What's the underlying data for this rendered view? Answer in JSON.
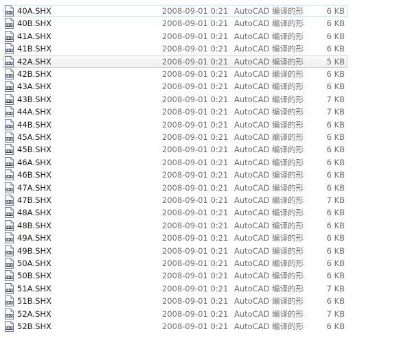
{
  "file_list": {
    "icon": "shx-file-icon",
    "icon_label": "SHX",
    "selected_index": 0,
    "hover_index": 4,
    "rows": [
      {
        "name": "40A.SHX",
        "date": "2008-09-01 0:21",
        "type": "AutoCAD 编译的形",
        "size": "6 KB"
      },
      {
        "name": "40B.SHX",
        "date": "2008-09-01 0:21",
        "type": "AutoCAD 编译的形",
        "size": "6 KB"
      },
      {
        "name": "41A.SHX",
        "date": "2008-09-01 0:21",
        "type": "AutoCAD 编译的形",
        "size": "6 KB"
      },
      {
        "name": "41B.SHX",
        "date": "2008-09-01 0:21",
        "type": "AutoCAD 编译的形",
        "size": "6 KB"
      },
      {
        "name": "42A.SHX",
        "date": "2008-09-01 0:21",
        "type": "AutoCAD 编译的形",
        "size": "5 KB"
      },
      {
        "name": "42B.SHX",
        "date": "2008-09-01 0:21",
        "type": "AutoCAD 编译的形",
        "size": "6 KB"
      },
      {
        "name": "43A.SHX",
        "date": "2008-09-01 0:21",
        "type": "AutoCAD 编译的形",
        "size": "6 KB"
      },
      {
        "name": "43B.SHX",
        "date": "2008-09-01 0:21",
        "type": "AutoCAD 编译的形",
        "size": "7 KB"
      },
      {
        "name": "44A.SHX",
        "date": "2008-09-01 0:21",
        "type": "AutoCAD 编译的形",
        "size": "7 KB"
      },
      {
        "name": "44B.SHX",
        "date": "2008-09-01 0:21",
        "type": "AutoCAD 编译的形",
        "size": "6 KB"
      },
      {
        "name": "45A.SHX",
        "date": "2008-09-01 0:21",
        "type": "AutoCAD 编译的形",
        "size": "6 KB"
      },
      {
        "name": "45B.SHX",
        "date": "2008-09-01 0:21",
        "type": "AutoCAD 编译的形",
        "size": "6 KB"
      },
      {
        "name": "46A.SHX",
        "date": "2008-09-01 0:21",
        "type": "AutoCAD 编译的形",
        "size": "6 KB"
      },
      {
        "name": "46B.SHX",
        "date": "2008-09-01 0:21",
        "type": "AutoCAD 编译的形",
        "size": "6 KB"
      },
      {
        "name": "47A.SHX",
        "date": "2008-09-01 0:21",
        "type": "AutoCAD 编译的形",
        "size": "6 KB"
      },
      {
        "name": "47B.SHX",
        "date": "2008-09-01 0:21",
        "type": "AutoCAD 编译的形",
        "size": "7 KB"
      },
      {
        "name": "48A.SHX",
        "date": "2008-09-01 0:21",
        "type": "AutoCAD 编译的形",
        "size": "6 KB"
      },
      {
        "name": "48B.SHX",
        "date": "2008-09-01 0:21",
        "type": "AutoCAD 编译的形",
        "size": "6 KB"
      },
      {
        "name": "49A.SHX",
        "date": "2008-09-01 0:21",
        "type": "AutoCAD 编译的形",
        "size": "6 KB"
      },
      {
        "name": "49B.SHX",
        "date": "2008-09-01 0:21",
        "type": "AutoCAD 编译的形",
        "size": "6 KB"
      },
      {
        "name": "50A.SHX",
        "date": "2008-09-01 0:21",
        "type": "AutoCAD 编译的形",
        "size": "6 KB"
      },
      {
        "name": "50B.SHX",
        "date": "2008-09-01 0:21",
        "type": "AutoCAD 编译的形",
        "size": "6 KB"
      },
      {
        "name": "51A.SHX",
        "date": "2008-09-01 0:21",
        "type": "AutoCAD 编译的形",
        "size": "7 KB"
      },
      {
        "name": "51B.SHX",
        "date": "2008-09-01 0:21",
        "type": "AutoCAD 编译的形",
        "size": "6 KB"
      },
      {
        "name": "52A.SHX",
        "date": "2008-09-01 0:21",
        "type": "AutoCAD 编译的形",
        "size": "7 KB"
      },
      {
        "name": "52B.SHX",
        "date": "2008-09-01 0:21",
        "type": "AutoCAD 编译的形",
        "size": "6 KB"
      }
    ]
  }
}
